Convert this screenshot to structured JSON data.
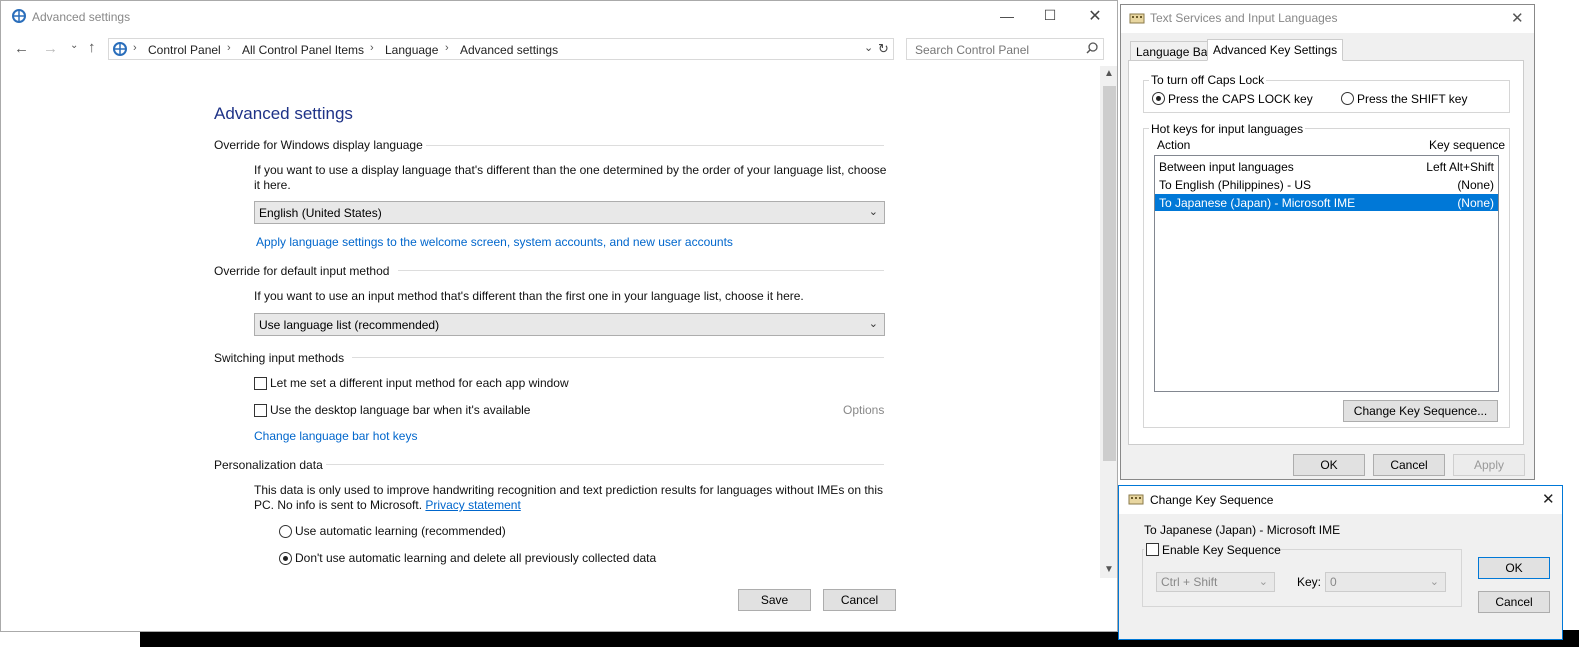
{
  "main_window": {
    "title": "Advanced settings",
    "breadcrumb": [
      "Control Panel",
      "All Control Panel Items",
      "Language",
      "Advanced settings"
    ],
    "search_placeholder": "Search Control Panel",
    "page_title": "Advanced settings",
    "override_display": {
      "heading": "Override for Windows display language",
      "description": "If you want to use a display language that's different than the one determined by the order of your language list, choose it here.",
      "selected": "English (United States)",
      "link": "Apply language settings to the welcome screen, system accounts, and new user accounts"
    },
    "override_input": {
      "heading": "Override for default input method",
      "description": "If you want to use an input method that's different than the first one in your language list, choose it here.",
      "selected": "Use language list (recommended)"
    },
    "switching": {
      "heading": "Switching input methods",
      "checkbox1": "Let me set a different input method for each app window",
      "checkbox2": "Use the desktop language bar when it's available",
      "options_label": "Options",
      "hotkeys_link": "Change language bar hot keys"
    },
    "personalization": {
      "heading": "Personalization data",
      "description": "This data is only used to improve handwriting recognition and text prediction results for languages without IMEs on this PC. No info is sent to Microsoft.",
      "privacy_link": "Privacy statement",
      "radio1": "Use automatic learning (recommended)",
      "radio2": "Don't use automatic learning and delete all previously collected data"
    },
    "save_label": "Save",
    "cancel_label": "Cancel"
  },
  "text_services": {
    "title": "Text Services and Input Languages",
    "tabs": [
      "Language Bar",
      "Advanced Key Settings"
    ],
    "caps_group": "To turn off Caps Lock",
    "caps_opt1": "Press the CAPS LOCK key",
    "caps_opt2": "Press the SHIFT key",
    "hotkeys_group": "Hot keys for input languages",
    "col_action": "Action",
    "col_key": "Key sequence",
    "rows": [
      {
        "action": "Between input languages",
        "key": "Left Alt+Shift"
      },
      {
        "action": "To English (Philippines) - US",
        "key": "(None)"
      },
      {
        "action": "To Japanese (Japan) - Microsoft IME",
        "key": "(None)"
      }
    ],
    "change_btn": "Change Key Sequence...",
    "ok": "OK",
    "cancel": "Cancel",
    "apply": "Apply"
  },
  "change_key": {
    "title": "Change Key Sequence",
    "target": "To Japanese (Japan) - Microsoft IME",
    "enable_label": "Enable Key Sequence",
    "modifier": "Ctrl + Shift",
    "key_label": "Key:",
    "key_value": "0",
    "ok": "OK",
    "cancel": "Cancel"
  }
}
